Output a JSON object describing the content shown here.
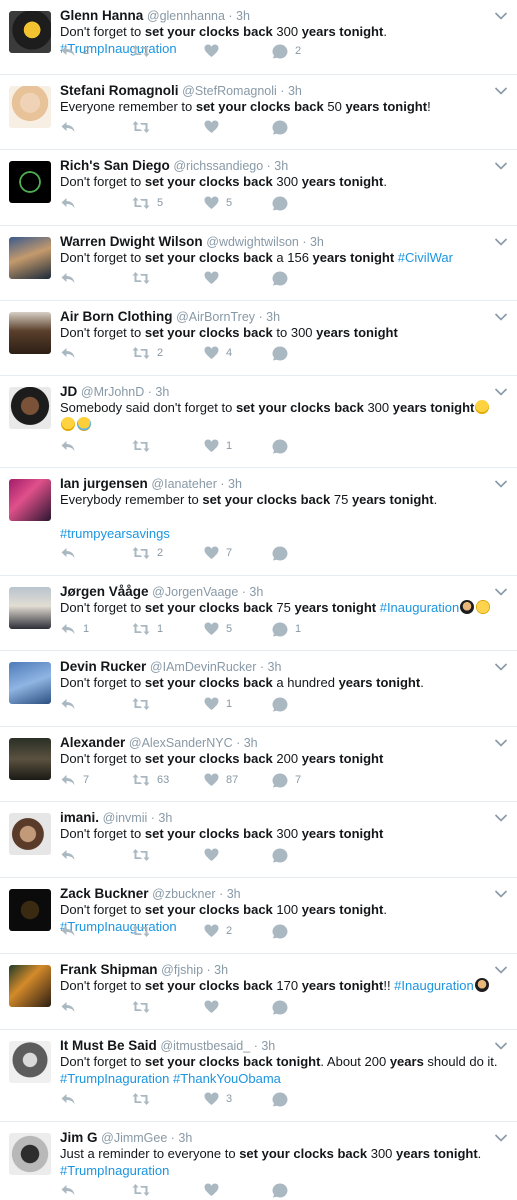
{
  "colors": {
    "link": "#1b95e0",
    "meta": "#8899a6",
    "text": "#14171a",
    "icon": "#aab8c2",
    "divider": "#e6ecf0"
  },
  "icons": {
    "reply": "reply-icon",
    "retweet": "retweet-icon",
    "like": "heart-icon",
    "message": "direct-message-icon",
    "menu": "chevron-down-icon"
  },
  "tweets": [
    {
      "name": "Glenn Hanna",
      "handle": "@glennhanna",
      "time": "3h",
      "text": [
        {
          "t": "Don't forget to "
        },
        {
          "b": "set your clocks back"
        },
        {
          "t": " 300 "
        },
        {
          "b": "years tonight"
        },
        {
          "t": ". "
        },
        {
          "h": "#TrumpInauguration"
        }
      ],
      "counts": {
        "reply": "2",
        "retweet": "",
        "like": "",
        "dm": "2"
      }
    },
    {
      "name": "Stefani Romagnoli",
      "handle": "@StefRomagnoli",
      "time": "3h",
      "text": [
        {
          "t": "Everyone remember to "
        },
        {
          "b": "set your clocks back"
        },
        {
          "t": " 50 "
        },
        {
          "b": "years tonight"
        },
        {
          "t": "!"
        }
      ],
      "counts": {
        "reply": "",
        "retweet": "",
        "like": "",
        "dm": ""
      }
    },
    {
      "name": "Rich's San Diego",
      "handle": "@richssandiego",
      "time": "3h",
      "text": [
        {
          "t": "Don't forget to "
        },
        {
          "b": "set your clocks back"
        },
        {
          "t": " 300 "
        },
        {
          "b": "years tonight"
        },
        {
          "t": "."
        }
      ],
      "counts": {
        "reply": "",
        "retweet": "5",
        "like": "5",
        "dm": ""
      }
    },
    {
      "name": "Warren Dwight Wilson",
      "handle": "@wdwightwilson",
      "time": "3h",
      "text": [
        {
          "t": "Don't forget to "
        },
        {
          "b": "set your clocks back"
        },
        {
          "t": " a 156 "
        },
        {
          "b": "years tonight"
        },
        {
          "t": " "
        },
        {
          "h": "#CivilWar"
        }
      ],
      "counts": {
        "reply": "",
        "retweet": "",
        "like": "",
        "dm": ""
      }
    },
    {
      "name": "Air Born Clothing",
      "handle": "@AirBornTrey",
      "time": "3h",
      "text": [
        {
          "t": "Don't forget to "
        },
        {
          "b": "set your clocks back"
        },
        {
          "t": " to 300 "
        },
        {
          "b": "years tonight"
        }
      ],
      "counts": {
        "reply": "",
        "retweet": "2",
        "like": "4",
        "dm": ""
      }
    },
    {
      "name": "JD",
      "handle": "@MrJohnD",
      "time": "3h",
      "text": [
        {
          "t": "Somebody said don't forget to "
        },
        {
          "b": "set your clocks back"
        },
        {
          "t": " 300 "
        },
        {
          "b": "years tonight"
        },
        {
          "e": "joy"
        },
        {
          "e": "joy"
        },
        {
          "e": "cry"
        }
      ],
      "counts": {
        "reply": "",
        "retweet": "",
        "like": "1",
        "dm": ""
      }
    },
    {
      "name": "Ian jurgensen",
      "handle": "@Ianateher",
      "time": "3h",
      "text": [
        {
          "t": "Everybody remember to "
        },
        {
          "b": "set your clocks back"
        },
        {
          "t": " 75 "
        },
        {
          "b": "years tonight"
        },
        {
          "t": "."
        },
        {
          "br": 2
        },
        {
          "h": "#trumpyearsavings"
        }
      ],
      "counts": {
        "reply": "",
        "retweet": "2",
        "like": "7",
        "dm": ""
      }
    },
    {
      "name": "Jørgen Vååge",
      "handle": "@JorgenVaage",
      "time": "3h",
      "text": [
        {
          "t": "Don't forget to "
        },
        {
          "b": "set your clocks back"
        },
        {
          "t": " 75 "
        },
        {
          "b": "years tonight"
        },
        {
          "t": " "
        },
        {
          "h": "#Inauguration"
        },
        {
          "e": "trump"
        },
        {
          "e": "unamused"
        }
      ],
      "counts": {
        "reply": "1",
        "retweet": "1",
        "like": "5",
        "dm": "1"
      }
    },
    {
      "name": "Devin Rucker",
      "handle": "@IAmDevinRucker",
      "time": "3h",
      "text": [
        {
          "t": "Don't forget to "
        },
        {
          "b": "set your clocks back"
        },
        {
          "t": " a hundred "
        },
        {
          "b": "years tonight"
        },
        {
          "t": "."
        }
      ],
      "counts": {
        "reply": "",
        "retweet": "",
        "like": "1",
        "dm": ""
      }
    },
    {
      "name": "Alexander",
      "handle": "@AlexSanderNYC",
      "time": "3h",
      "text": [
        {
          "t": "Don't forget to "
        },
        {
          "b": "set your clocks back"
        },
        {
          "t": " 200 "
        },
        {
          "b": "years tonight"
        }
      ],
      "counts": {
        "reply": "7",
        "retweet": "63",
        "like": "87",
        "dm": "7"
      }
    },
    {
      "name": "imani.",
      "handle": "@invmii",
      "time": "3h",
      "text": [
        {
          "t": "Don't forget to "
        },
        {
          "b": "set your clocks back"
        },
        {
          "t": " 300 "
        },
        {
          "b": "years tonight"
        }
      ],
      "counts": {
        "reply": "",
        "retweet": "",
        "like": "",
        "dm": ""
      }
    },
    {
      "name": "Zack Buckner",
      "handle": "@zbuckner",
      "time": "3h",
      "text": [
        {
          "t": "Don't forget to "
        },
        {
          "b": "set your clocks back"
        },
        {
          "t": " 100 "
        },
        {
          "b": "years tonight"
        },
        {
          "t": ". "
        },
        {
          "h": "#TrumpInauguration"
        }
      ],
      "counts": {
        "reply": "",
        "retweet": "",
        "like": "2",
        "dm": ""
      }
    },
    {
      "name": "Frank Shipman",
      "handle": "@fjship",
      "time": "3h",
      "text": [
        {
          "t": "Don't forget to "
        },
        {
          "b": "set your clocks back"
        },
        {
          "t": " 170 "
        },
        {
          "b": "years tonight"
        },
        {
          "t": "!! "
        },
        {
          "h": "#Inauguration"
        },
        {
          "e": "trump"
        }
      ],
      "counts": {
        "reply": "",
        "retweet": "",
        "like": "",
        "dm": ""
      }
    },
    {
      "name": "It Must Be Said",
      "handle": "@itmustbesaid_",
      "time": "3h",
      "text": [
        {
          "t": "Don't forget to "
        },
        {
          "b": "set your clocks back tonight"
        },
        {
          "t": ". About 200 "
        },
        {
          "b": "years"
        },
        {
          "t": " should do it."
        },
        {
          "br": 1
        },
        {
          "h": "#TrumpInaguration"
        },
        {
          "t": " "
        },
        {
          "h": "#ThankYouObama"
        }
      ],
      "counts": {
        "reply": "",
        "retweet": "",
        "like": "3",
        "dm": ""
      }
    },
    {
      "name": "Jim G",
      "handle": "@JimmGee",
      "time": "3h",
      "text": [
        {
          "t": "Just a reminder to everyone to "
        },
        {
          "b": "set your clocks back"
        },
        {
          "t": " 300 "
        },
        {
          "b": "years tonight"
        },
        {
          "t": "."
        },
        {
          "br": 1
        },
        {
          "h": "#TrumpInaguration"
        }
      ],
      "counts": {
        "reply": "",
        "retweet": "",
        "like": "",
        "dm": ""
      }
    }
  ]
}
